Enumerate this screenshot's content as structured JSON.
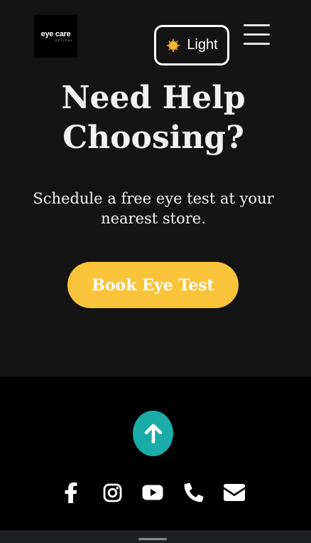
{
  "header": {
    "logo": {
      "brand": "eye care",
      "sub": "OPTICAL"
    },
    "theme_toggle": {
      "label": "Light",
      "icon": "sun-icon"
    },
    "menu": {
      "icon": "hamburger-menu-icon"
    }
  },
  "hero": {
    "title_line1": "Need Help",
    "title_line2": "Choosing?",
    "subtitle_line1": "Schedule a free eye test at your",
    "subtitle_line2": "nearest store.",
    "cta_label": "Book Eye Test"
  },
  "footer": {
    "scroll_top_icon": "arrow-up-icon",
    "social": [
      "facebook-icon",
      "instagram-icon",
      "youtube-icon",
      "phone-icon",
      "email-icon"
    ]
  },
  "colors": {
    "background": "#141414",
    "footer": "#000000",
    "accent_yellow": "#f9c43a",
    "accent_teal": "#1aaca8"
  }
}
